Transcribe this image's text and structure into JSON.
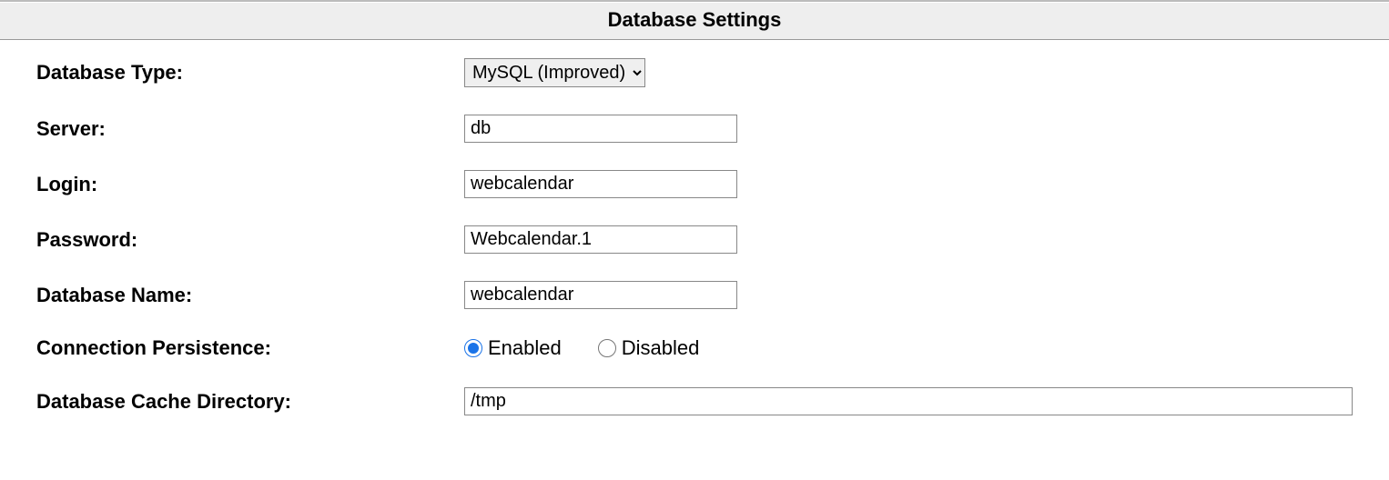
{
  "header": {
    "title": "Database Settings"
  },
  "fields": {
    "db_type": {
      "label": "Database Type:",
      "selected": "MySQL (Improved)"
    },
    "server": {
      "label": "Server:",
      "value": "db"
    },
    "login": {
      "label": "Login:",
      "value": "webcalendar"
    },
    "password": {
      "label": "Password:",
      "value": "Webcalendar.1"
    },
    "db_name": {
      "label": "Database Name:",
      "value": "webcalendar"
    },
    "conn_persist": {
      "label": "Connection Persistence:",
      "enabled_label": "Enabled",
      "disabled_label": "Disabled"
    },
    "cache_dir": {
      "label": "Database Cache Directory:",
      "value": "/tmp"
    }
  }
}
